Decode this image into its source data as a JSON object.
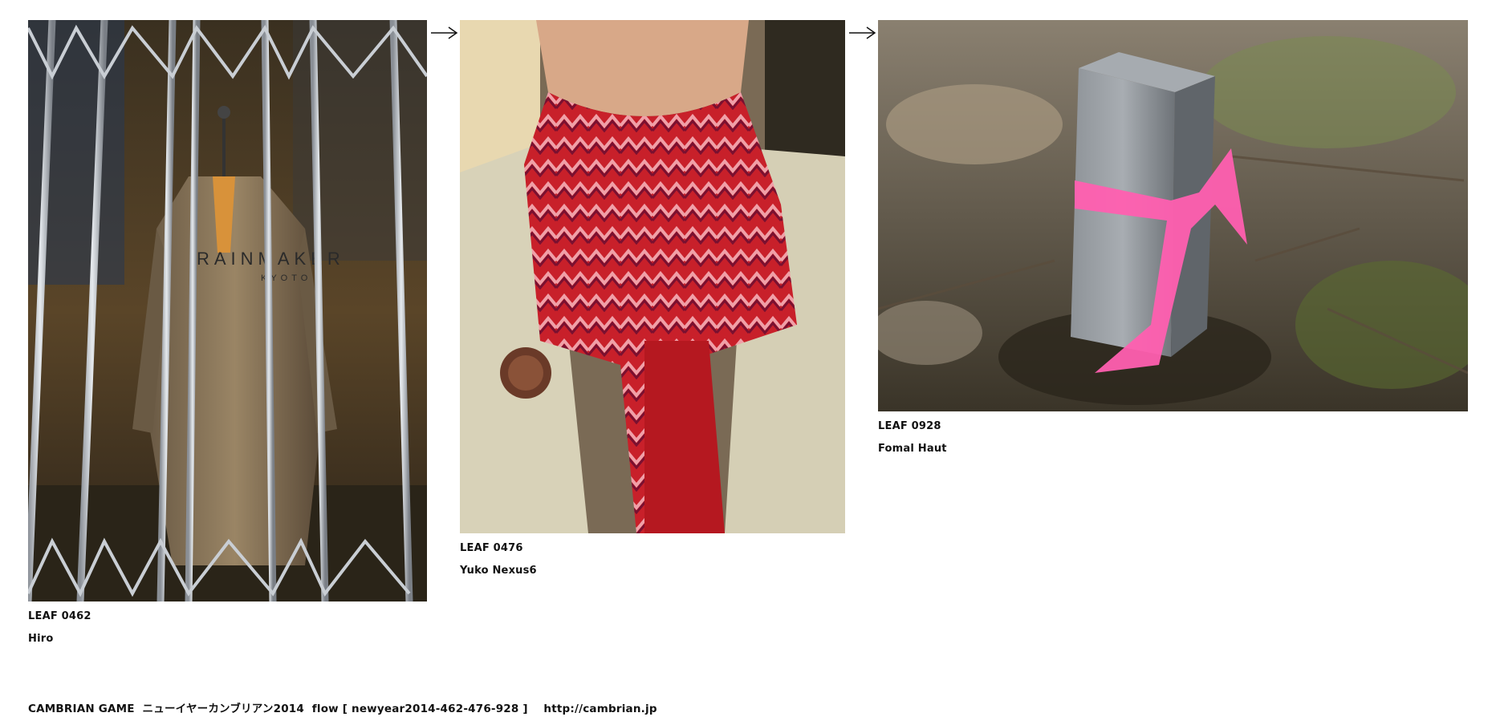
{
  "leaves": [
    {
      "leaf_label": "LEAF 0462",
      "author": "Hiro",
      "photo_text": "RAINMAKER",
      "photo_subtext": "KYOTO"
    },
    {
      "leaf_label": "LEAF 0476",
      "author": "Yuko Nexus6"
    },
    {
      "leaf_label": "LEAF 0928",
      "author": "Fomal Haut"
    }
  ],
  "arrows": [
    "arrow-right-icon",
    "arrow-right-icon"
  ],
  "footer": {
    "title": "CAMBRIAN GAME",
    "subtitle": "ニューイヤーカンブリアン2014",
    "flow": "flow [ newyear2014-462-476-928 ]",
    "url": "http://cambrian.jp"
  }
}
